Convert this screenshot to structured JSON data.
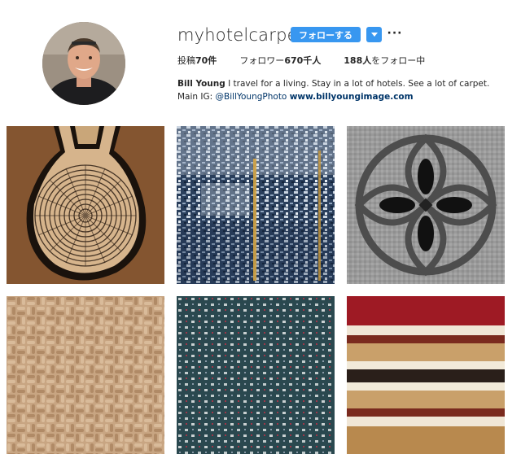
{
  "profile": {
    "username": "myhotelcarpet",
    "follow_label": "フォローする",
    "more_label": "···",
    "stats": {
      "posts_label": "投稿",
      "posts_count": "70件",
      "followers_label": "フォロワー",
      "followers_count": "670千人",
      "following_count": "188人",
      "following_label": "をフォロー中"
    },
    "bio": {
      "name": "Bill Young",
      "text": "I travel for a living. Stay in a lot of hotels. See a lot of carpet. Main IG:",
      "mention": "@BillYoungPhoto",
      "website": "www.billyoungimage.com"
    }
  },
  "colors": {
    "accent": "#3897f0",
    "link": "#003569",
    "text": "#262626"
  },
  "posts": [
    {
      "name": "post-round-rug",
      "pattern": "concentric-woven-circle"
    },
    {
      "name": "post-blue-speckled",
      "pattern": "blue-speckled-weave"
    },
    {
      "name": "post-gray-medallion",
      "pattern": "circle-quatrefoil"
    },
    {
      "name": "post-tan-basketweave",
      "pattern": "tan-basketweave"
    },
    {
      "name": "post-teal-dots",
      "pattern": "teal-dots"
    },
    {
      "name": "post-red-stripes",
      "pattern": "red-tan-stripes"
    }
  ]
}
